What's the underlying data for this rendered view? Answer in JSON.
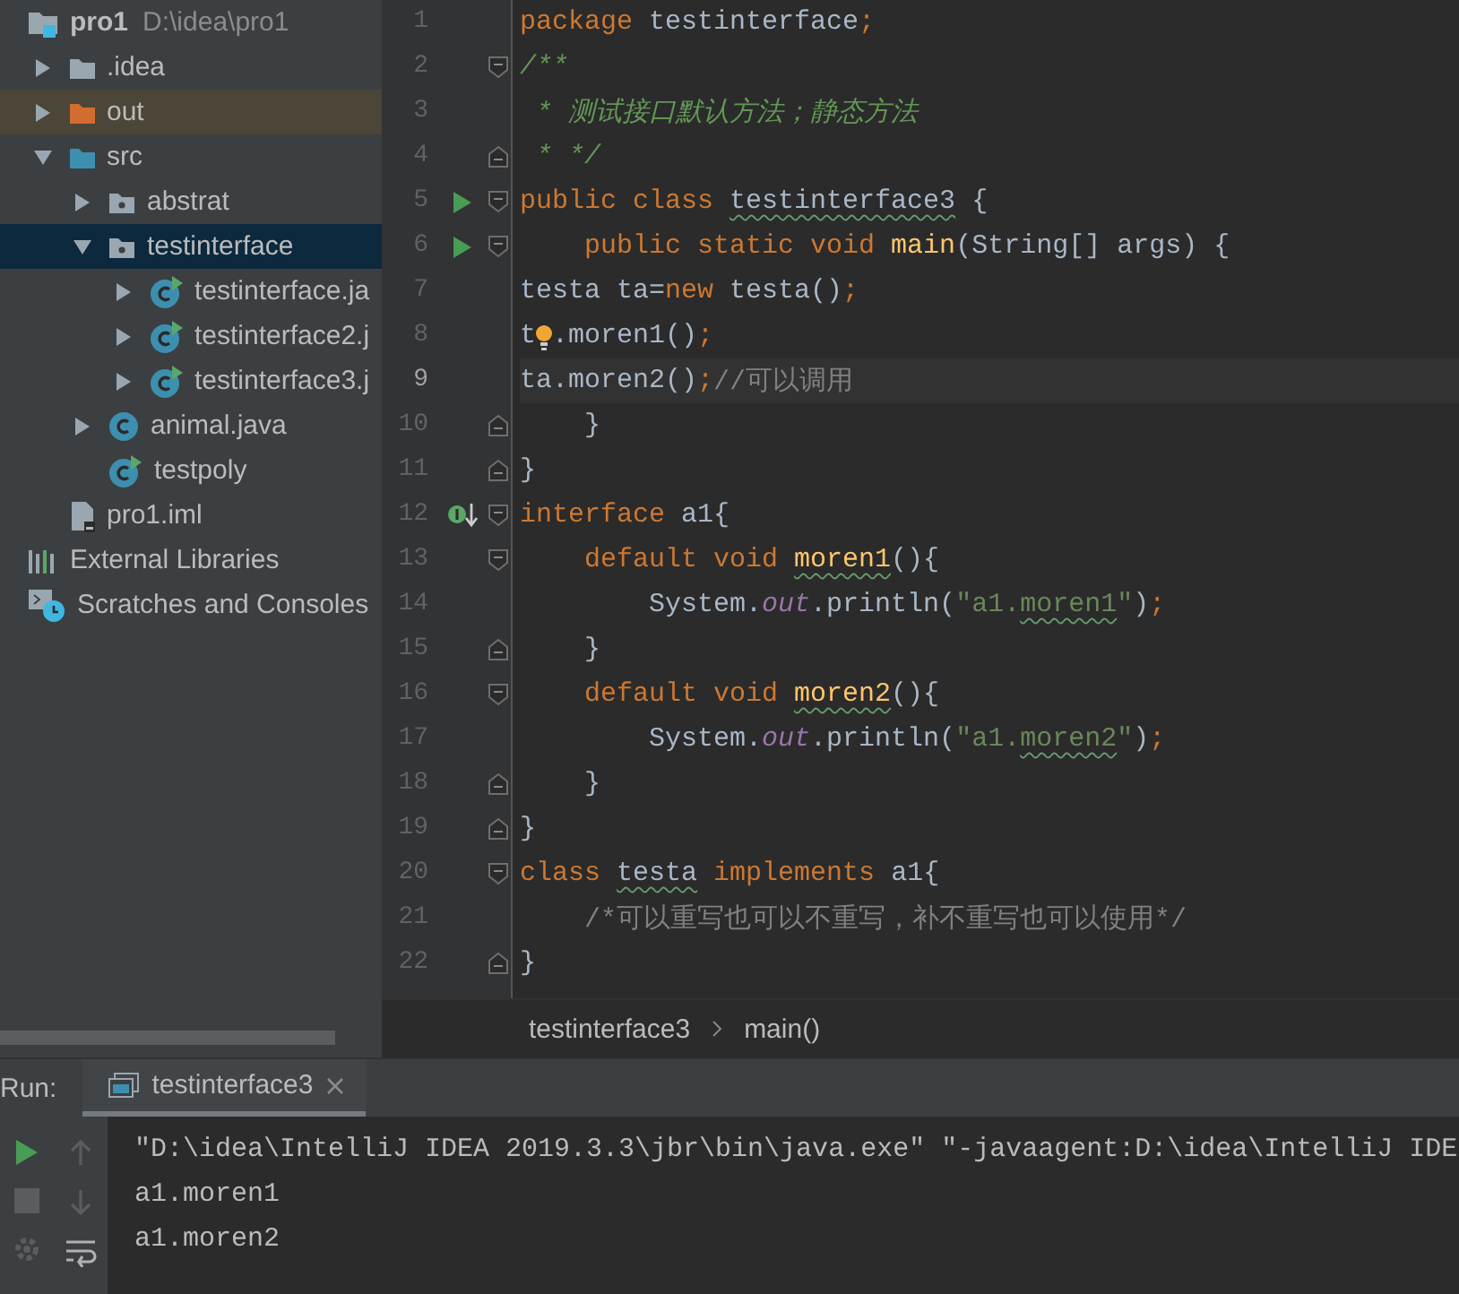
{
  "project_tree": [
    {
      "name": "pro1",
      "path": "D:\\idea\\pro1",
      "kind": "module",
      "selected": false,
      "children": [
        {
          "name": ".idea",
          "kind": "folder",
          "expanded": false,
          "selected": false
        },
        {
          "name": "out",
          "kind": "excluded-folder",
          "expanded": false,
          "selected": false
        },
        {
          "name": "src",
          "kind": "source-folder",
          "expanded": true,
          "selected": false,
          "children": [
            {
              "name": "abstrat",
              "kind": "package",
              "expanded": false,
              "selected": false
            },
            {
              "name": "testinterface",
              "kind": "package",
              "expanded": true,
              "selected": true,
              "children": [
                {
                  "name": "testinterface.ja",
                  "kind": "runnable-class",
                  "expanded": false,
                  "selected": false
                },
                {
                  "name": "testinterface2.j",
                  "kind": "runnable-class",
                  "expanded": false,
                  "selected": false
                },
                {
                  "name": "testinterface3.j",
                  "kind": "runnable-class",
                  "expanded": false,
                  "selected": false
                }
              ]
            },
            {
              "name": "animal.java",
              "kind": "class",
              "expanded": false,
              "selected": false
            },
            {
              "name": "testpoly",
              "kind": "runnable-class",
              "selected": false
            }
          ]
        },
        {
          "name": "pro1.iml",
          "kind": "iml",
          "selected": false
        }
      ]
    },
    {
      "name": "External Libraries",
      "kind": "libraries",
      "selected": false
    },
    {
      "name": "Scratches and Consoles",
      "kind": "scratches",
      "selected": false
    }
  ],
  "editor": {
    "lines": [
      {
        "number": "1",
        "tokens": [
          {
            "kind": "keyword",
            "text": "package "
          },
          {
            "kind": "plain",
            "text": "testinterface"
          },
          {
            "kind": "keyword",
            "text": ";"
          }
        ]
      },
      {
        "number": "2",
        "fold_start": true,
        "tokens": [
          {
            "kind": "doc",
            "text": "/**"
          }
        ]
      },
      {
        "number": "3",
        "tokens": [
          {
            "kind": "doc",
            "text": " * 测试接口默认方法；静态方法"
          }
        ]
      },
      {
        "number": "4",
        "fold_end": true,
        "tokens": [
          {
            "kind": "doc",
            "text": " * */"
          }
        ]
      },
      {
        "number": "5",
        "run_marker": true,
        "fold_start": true,
        "tokens": [
          {
            "kind": "keyword",
            "text": "public class "
          },
          {
            "kind": "plain",
            "text": "testinterface3",
            "typo": true
          },
          {
            "kind": "plain",
            "text": " {"
          }
        ]
      },
      {
        "number": "6",
        "run_marker": true,
        "fold_start": true,
        "tokens": [
          {
            "kind": "keyword",
            "text": "    public static void "
          },
          {
            "kind": "method",
            "text": "main"
          },
          {
            "kind": "plain",
            "text": "(String[] args) {"
          }
        ]
      },
      {
        "number": "7",
        "tokens": [
          {
            "kind": "plain",
            "text": "testa ta="
          },
          {
            "kind": "keyword",
            "text": "new "
          },
          {
            "kind": "plain",
            "text": "testa()"
          },
          {
            "kind": "keyword",
            "text": ";"
          }
        ]
      },
      {
        "number": "8",
        "tokens": [
          {
            "kind": "plain",
            "text": "t"
          },
          {
            "kind": "bulb"
          },
          {
            "kind": "plain",
            "text": ".moren1()"
          },
          {
            "kind": "keyword",
            "text": ";"
          }
        ]
      },
      {
        "number": "9",
        "current": true,
        "tokens": [
          {
            "kind": "plain",
            "text": "ta.moren2()"
          },
          {
            "kind": "keyword",
            "text": ";"
          },
          {
            "kind": "comment",
            "text": "//可以调用"
          }
        ]
      },
      {
        "number": "10",
        "fold_end": true,
        "tokens": [
          {
            "kind": "plain",
            "text": "    }"
          }
        ]
      },
      {
        "number": "11",
        "fold_end": true,
        "tokens": [
          {
            "kind": "plain",
            "text": "}"
          }
        ]
      },
      {
        "number": "12",
        "implemented_marker": true,
        "fold_start": true,
        "tokens": [
          {
            "kind": "keyword",
            "text": "interface "
          },
          {
            "kind": "plain",
            "text": "a1{"
          }
        ]
      },
      {
        "number": "13",
        "fold_start": true,
        "tokens": [
          {
            "kind": "keyword",
            "text": "    default void "
          },
          {
            "kind": "method",
            "text": "moren1",
            "typo": true
          },
          {
            "kind": "plain",
            "text": "(){"
          }
        ]
      },
      {
        "number": "14",
        "tokens": [
          {
            "kind": "plain",
            "text": "        System."
          },
          {
            "kind": "field",
            "text": "out"
          },
          {
            "kind": "plain",
            "text": ".println("
          },
          {
            "kind": "string",
            "text": "\"a1."
          },
          {
            "kind": "string",
            "text": "moren1",
            "typo": true
          },
          {
            "kind": "string",
            "text": "\""
          },
          {
            "kind": "plain",
            "text": ")"
          },
          {
            "kind": "keyword",
            "text": ";"
          }
        ]
      },
      {
        "number": "15",
        "fold_end": true,
        "tokens": [
          {
            "kind": "plain",
            "text": "    }"
          }
        ]
      },
      {
        "number": "16",
        "fold_start": true,
        "tokens": [
          {
            "kind": "keyword",
            "text": "    default void "
          },
          {
            "kind": "method",
            "text": "moren2",
            "typo": true
          },
          {
            "kind": "plain",
            "text": "(){"
          }
        ]
      },
      {
        "number": "17",
        "tokens": [
          {
            "kind": "plain",
            "text": "        System."
          },
          {
            "kind": "field",
            "text": "out"
          },
          {
            "kind": "plain",
            "text": ".println("
          },
          {
            "kind": "string",
            "text": "\"a1."
          },
          {
            "kind": "string",
            "text": "moren2",
            "typo": true
          },
          {
            "kind": "string",
            "text": "\""
          },
          {
            "kind": "plain",
            "text": ")"
          },
          {
            "kind": "keyword",
            "text": ";"
          }
        ]
      },
      {
        "number": "18",
        "fold_end": true,
        "tokens": [
          {
            "kind": "plain",
            "text": "    }"
          }
        ]
      },
      {
        "number": "19",
        "fold_end": true,
        "tokens": [
          {
            "kind": "plain",
            "text": "}"
          }
        ]
      },
      {
        "number": "20",
        "fold_start": true,
        "tokens": [
          {
            "kind": "keyword",
            "text": "class "
          },
          {
            "kind": "plain",
            "text": "testa",
            "typo": true
          },
          {
            "kind": "keyword",
            "text": " implements "
          },
          {
            "kind": "plain",
            "text": "a1{"
          }
        ]
      },
      {
        "number": "21",
        "tokens": [
          {
            "kind": "comment",
            "text": "    /*可以重写也可以不重写，补不重写也可以使用*/"
          }
        ]
      },
      {
        "number": "22",
        "fold_end": true,
        "tokens": [
          {
            "kind": "plain",
            "text": "}"
          }
        ]
      }
    ]
  },
  "breadcrumbs": [
    "testinterface3",
    "main()"
  ],
  "run_panel": {
    "label": "Run:",
    "tabs": [
      {
        "label": "testinterface3",
        "selected": true
      }
    ],
    "console_lines": [
      "\"D:\\idea\\IntelliJ IDEA 2019.3.3\\jbr\\bin\\java.exe\" \"-javaagent:D:\\idea\\IntelliJ IDE",
      "a1.moren1",
      "a1.moren2"
    ]
  }
}
